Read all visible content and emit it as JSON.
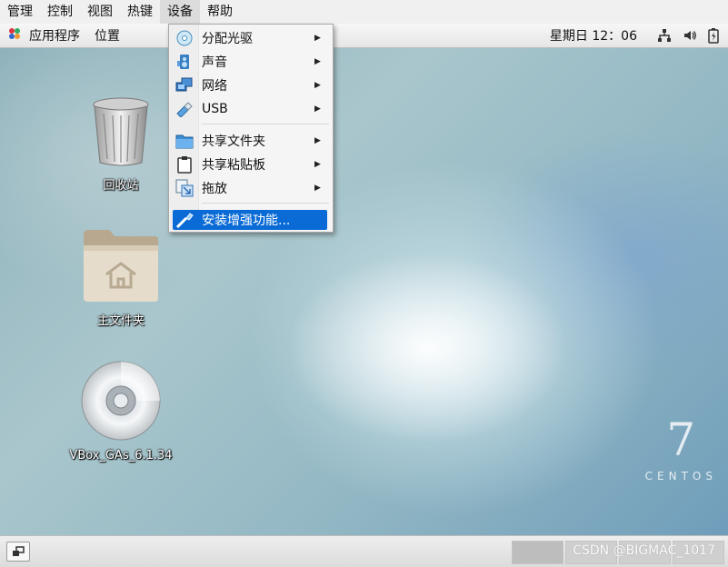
{
  "vbox_menubar": {
    "items": [
      "管理",
      "控制",
      "视图",
      "热键",
      "设备",
      "帮助"
    ],
    "active_index": 4
  },
  "top_panel": {
    "applications_label": "应用程序",
    "places_label": "位置",
    "clock": "星期日 12：06",
    "status_icons": [
      "network-icon",
      "volume-icon",
      "battery-icon"
    ]
  },
  "desktop": {
    "icons": [
      {
        "name": "trash-icon",
        "label": "回收站"
      },
      {
        "name": "home-folder-icon",
        "label": "主文件夹"
      },
      {
        "name": "optical-disc-icon",
        "label": "VBox_GAs_6.1.34"
      }
    ],
    "brand_number": "7",
    "brand_word": "CENTOS"
  },
  "devices_menu": {
    "items": [
      {
        "icon": "optical-drive-icon",
        "label": "分配光驱",
        "submenu": true
      },
      {
        "icon": "audio-icon",
        "label": "声音",
        "submenu": true
      },
      {
        "icon": "network-adapter-icon",
        "label": "网络",
        "submenu": true
      },
      {
        "icon": "usb-icon",
        "label": "USB",
        "submenu": true
      },
      {
        "icon": "shared-folder-icon",
        "label": "共享文件夹",
        "submenu": true
      },
      {
        "icon": "clipboard-icon",
        "label": "共享粘贴板",
        "submenu": true
      },
      {
        "icon": "drag-drop-icon",
        "label": "拖放",
        "submenu": true
      },
      {
        "icon": "install-guest-additions-icon",
        "label": "安装增强功能...",
        "submenu": false,
        "highlighted": true
      }
    ],
    "highlight_color": "#0a6bd6"
  },
  "bottom_panel": {
    "watermark": "CSDN @BIGMAC_1017",
    "workspace_count": 4,
    "active_workspace_index": 0
  }
}
